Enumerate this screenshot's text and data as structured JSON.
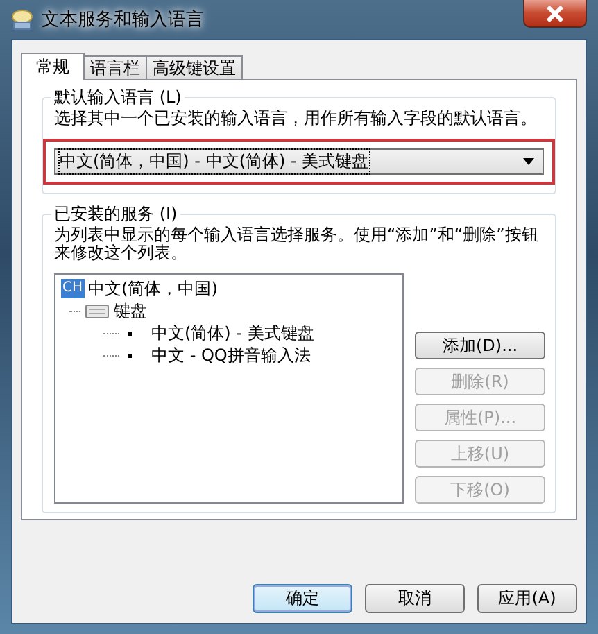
{
  "window": {
    "title": "文本服务和输入语言"
  },
  "tabs": [
    {
      "label": "常规",
      "selected": true
    },
    {
      "label": "语言栏",
      "selected": false
    },
    {
      "label": "高级键设置",
      "selected": false
    }
  ],
  "default_language": {
    "label": "默认输入语言 (L)",
    "description": "选择其中一个已安装的输入语言，用作所有输入字段的默认语言。",
    "dropdown": {
      "value": "中文(简体，中国) - 中文(简体) - 美式键盘",
      "highlighted": true
    }
  },
  "installed_services": {
    "label": "已安装的服务 (I)",
    "description": "为列表中显示的每个输入语言选择服务。使用“添加”和“删除”按钮来修改这个列表。",
    "tree": [
      {
        "badge": "CH",
        "label": "中文(简体，中国)",
        "children": [
          {
            "label": "键盘",
            "children": [
              {
                "label": "中文(简体) - 美式键盘"
              },
              {
                "label": "中文 - QQ拼音输入法"
              }
            ]
          }
        ]
      }
    ],
    "buttons": [
      {
        "label": "添加(D)...",
        "disabled": false
      },
      {
        "label": "删除(R)",
        "disabled": true
      },
      {
        "label": "属性(P)...",
        "disabled": true
      },
      {
        "label": "上移(U)",
        "disabled": true
      },
      {
        "label": "下移(O)",
        "disabled": true
      }
    ]
  },
  "footer_buttons": [
    {
      "label": "确定",
      "default": true
    },
    {
      "label": "取消",
      "default": false
    },
    {
      "label": "应用(A)",
      "default": false
    }
  ]
}
